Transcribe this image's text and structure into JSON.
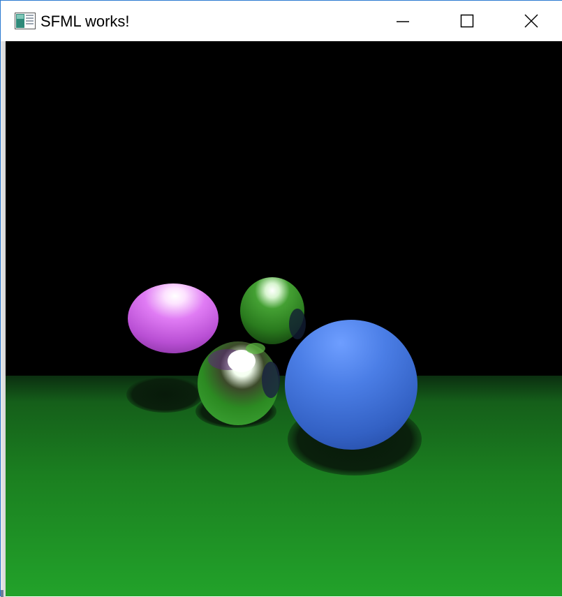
{
  "window": {
    "title": "SFML works!",
    "icon": "sfml-app-icon",
    "controls": {
      "minimize_icon": "minimize-icon",
      "maximize_icon": "maximize-icon",
      "close_icon": "close-icon"
    },
    "border_color": "#2b79d0"
  },
  "scene": {
    "background_color": "#000000",
    "floor_color": "#1f8f25",
    "objects": [
      {
        "name": "pink-sphere",
        "color": "#c060d8"
      },
      {
        "name": "green-glossy-sphere-top",
        "color": "#2e8f22"
      },
      {
        "name": "green-glossy-sphere-bottom",
        "color": "#3a8a2a"
      },
      {
        "name": "blue-sphere",
        "color": "#3f6fd0"
      }
    ]
  }
}
